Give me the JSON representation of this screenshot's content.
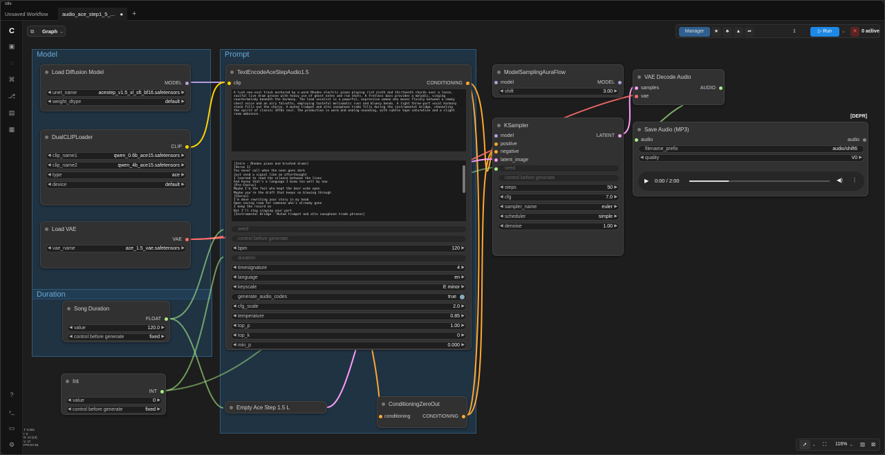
{
  "app": {
    "title": "Idle"
  },
  "tabs": [
    {
      "label": "Unsaved Workflow"
    },
    {
      "label": "audio_ace_step1_5_..."
    }
  ],
  "view": {
    "mode": "Graph"
  },
  "toolbar": {
    "manager": "Manager",
    "queue_count": "1",
    "run": "Run",
    "active": "0 active"
  },
  "groups": {
    "model": "Model",
    "prompt": "Prompt",
    "duration": "Duration"
  },
  "nodes": {
    "load_diffusion": {
      "title": "Load Diffusion Model",
      "out": "MODEL",
      "unet_name_label": "unet_name",
      "unet_name": "acestep_v1.5_xl_sft_bf16.safetensors",
      "weight_dtype_label": "weight_dtype",
      "weight_dtype": "default"
    },
    "dual_clip": {
      "title": "DualCLIPLoader",
      "out": "CLIP",
      "clip_name1_label": "clip_name1",
      "clip_name1": "qwen_0.6b_ace15.safetensors",
      "clip_name2_label": "clip_name2",
      "clip_name2": "qwen_4b_ace15.safetensors",
      "type_label": "type",
      "type": "ace",
      "device_label": "device",
      "device": "default"
    },
    "load_vae": {
      "title": "Load VAE",
      "out": "VAE",
      "vae_name_label": "vae_name",
      "vae_name": "ace_1.5_vae.safetensors"
    },
    "text_encode": {
      "title": "TextEncodeAceStepAudio1.5",
      "in_clip": "clip",
      "out": "CONDITIONING",
      "tags": "A lush neo-soul track anchored by a warm Rhodes electric piano playing rich ninth and thirteenth chords over a loose,\nsoulful live drum groove with heavy use of ghost notes and rim shots. A fretless bass provides a melodic, singing\ncountermelody beneath the harmony. The lead vocalist is a powerful, expressive woman who moves fluidly between a smoky\nchest voice and an airy falsetto, employing tasteful melismatic runs and bluesy bends. A tight three-part vocal harmony\nstack fills out the chorus. A muted trumpet and alto saxophone trade fills during the instrumental bridge, channeling\nthe spirit of classic 1970s soul. The production is warm and analog-sounding, with subtle tape saturation and a slight\nroom ambience.",
      "lyrics": "[Intro - Rhodes piano and brushed drums]\n[Verse 1]\nYou never call when the neon goes dark\nJust send a signal like an afterthought\nI learned to read the silence between the lines\nAnd honey that's a language I know too well by now\n[Pre-Chorus]\nMaybe I'm the fool who kept the door wide open\nMaybe you're the draft that keeps on blowing through\n[Chorus]\nI'm done rewriting your story in my head\nOpen saving room for someone who's already gone\nI keep the record on\nBut I'll stop singing your part\n[Instrumental Bridge - Muted trumpet and alto saxophone trade phrases]",
      "seed": "seed",
      "control": "control before generate",
      "bpm_label": "bpm",
      "bpm": "120",
      "duration": "duration",
      "timesig_label": "timesignature",
      "timesig": "4",
      "language_label": "language",
      "language": "en",
      "keyscale_label": "keyscale",
      "keyscale": "E minor",
      "gen_codes_label": "generate_audio_codes",
      "gen_codes": "true",
      "cfg_scale_label": "cfg_scale",
      "cfg_scale": "2.0",
      "temperature_label": "temperature",
      "temperature": "0.85",
      "top_p_label": "top_p",
      "top_p": "1.00",
      "top_k_label": "top_k",
      "top_k": "0",
      "min_p_label": "min_p",
      "min_p": "0.000"
    },
    "model_sampling": {
      "title": "ModelSamplingAuraFlow",
      "in": "model",
      "out": "MODEL",
      "shift_label": "shift",
      "shift": "3.00"
    },
    "ksampler": {
      "title": "KSampler",
      "in_model": "model",
      "in_pos": "positive",
      "in_neg": "negative",
      "in_latent": "latent_image",
      "in_seed": "seed",
      "out": "LATENT",
      "control": "control before generate",
      "steps_label": "steps",
      "steps": "50",
      "cfg_label": "cfg",
      "cfg": "7.0",
      "sampler_label": "sampler_name",
      "sampler": "euler",
      "scheduler_label": "scheduler",
      "scheduler": "simple",
      "denoise_label": "denoise",
      "denoise": "1.00"
    },
    "vae_decode": {
      "title": "VAE Decode Audio",
      "in_samples": "samples",
      "in_vae": "vae",
      "out": "AUDIO"
    },
    "save_audio": {
      "title": "Save Audio (MP3)",
      "badge": "[DEPR]",
      "in": "audio",
      "out": "audio",
      "prefix_label": "filename_prefix",
      "prefix": "audio/shift6",
      "quality_label": "quality",
      "quality": "V0",
      "time": "0:00 / 2:00"
    },
    "song_duration": {
      "title": "Song Duration",
      "out": "FLOAT",
      "value_label": "value",
      "value": "120.0",
      "control_label": "control before generate",
      "control": "fixed"
    },
    "int": {
      "title": "Int",
      "out": "INT",
      "value_label": "value",
      "value": "0",
      "control_label": "control before generate",
      "control": "fixed"
    },
    "empty_latent": {
      "title": "Empty Ace Step 1.5 L"
    },
    "cond_zero": {
      "title": "ConditioningZeroOut",
      "in": "conditioning",
      "out": "CONDITIONING"
    }
  },
  "bottom": {
    "zoom": "116%"
  },
  "stats": {
    "l1": "T: 0.00s",
    "l2": "I: 0",
    "l3": "N: 12 [12]",
    "l4": "V: 27",
    "l5": "FPS:57.66"
  },
  "colors": {
    "model": "#b39ddb",
    "clip": "#ffd500",
    "vae": "#ff6e6e",
    "conditioning": "#ffa931",
    "latent": "#ff9cf9",
    "float": "#aaee88",
    "int": "#aaee88",
    "accent": "#1e88e5"
  }
}
